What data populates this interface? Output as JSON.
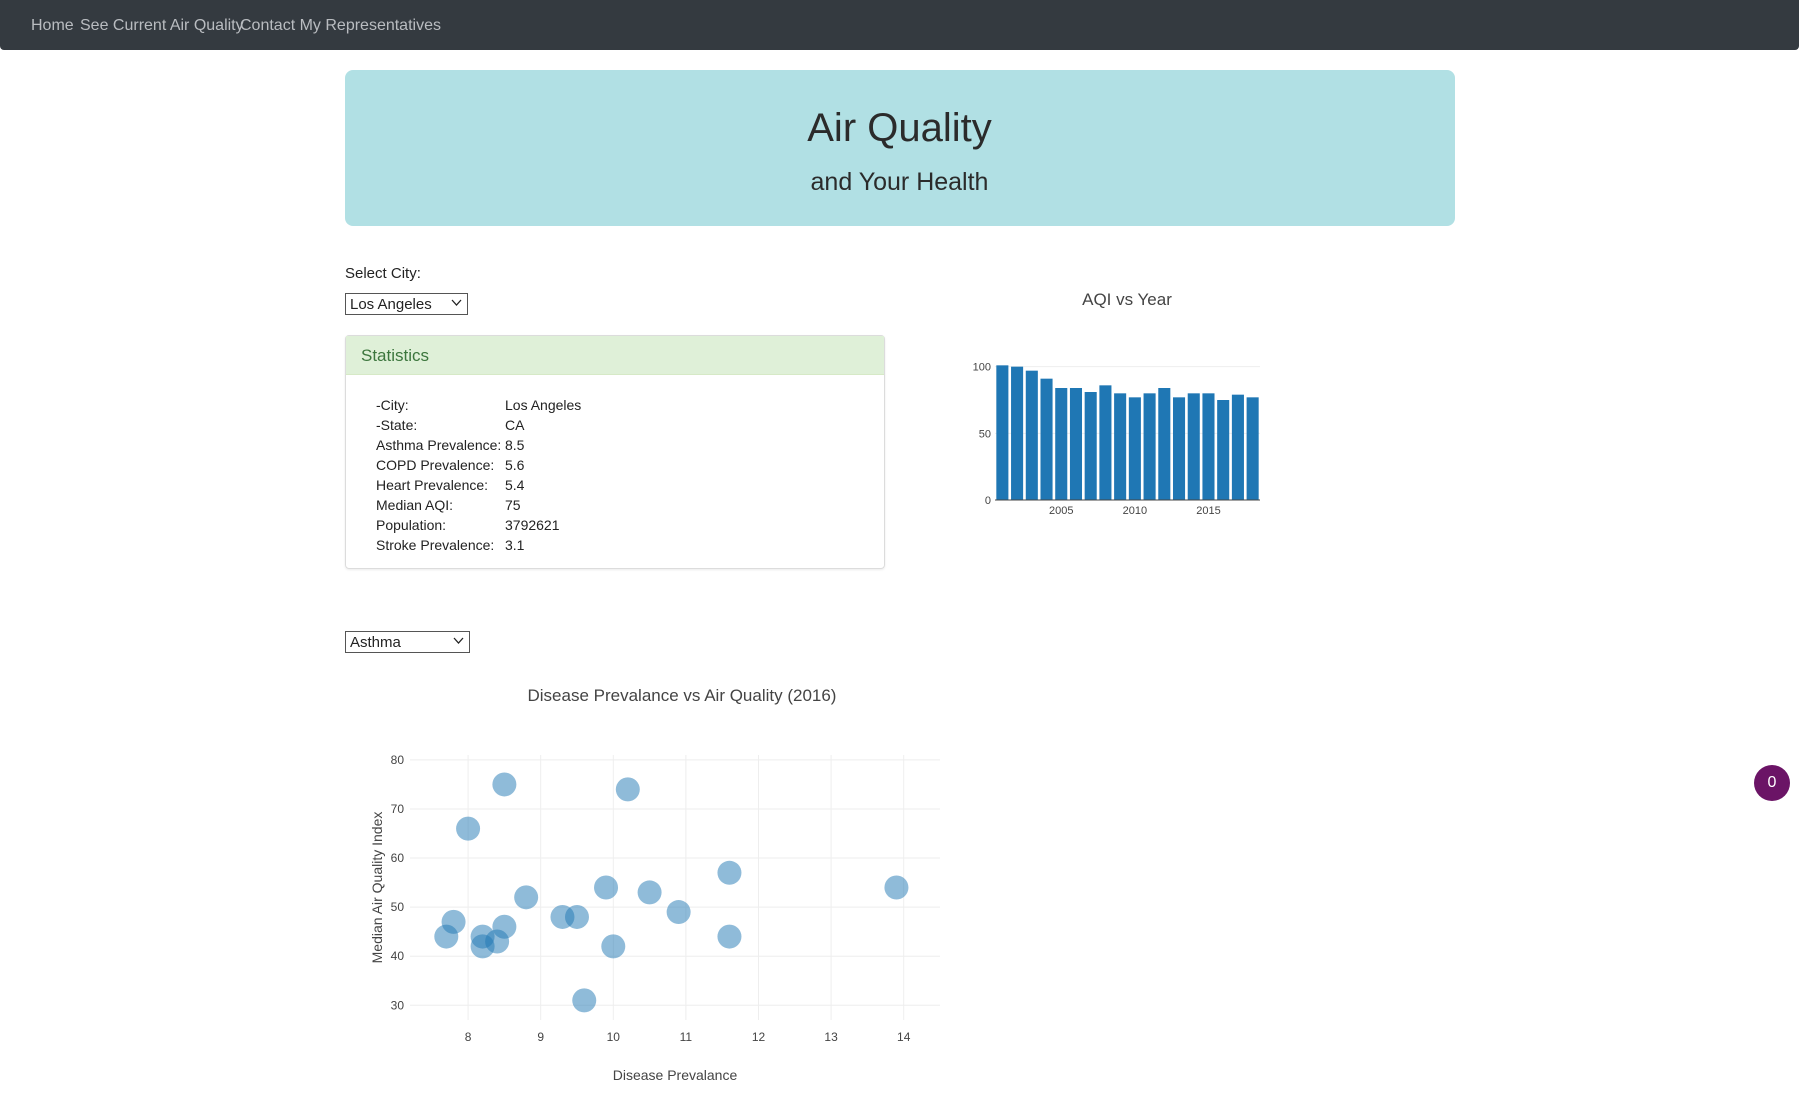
{
  "nav": {
    "items": [
      {
        "label": "Home"
      },
      {
        "label": "See Current Air Quality"
      },
      {
        "label": "Contact My Representatives"
      }
    ]
  },
  "jumbotron": {
    "title": "Air Quality",
    "subtitle": "and Your Health"
  },
  "city_select": {
    "label": "Select City:",
    "value": "Los Angeles"
  },
  "statistics": {
    "title": "Statistics",
    "rows": [
      {
        "key": "-City:",
        "value": "Los Angeles"
      },
      {
        "key": "-State:",
        "value": "CA"
      },
      {
        "key": "Asthma Prevalence:",
        "value": "8.5"
      },
      {
        "key": "COPD Prevalence:",
        "value": "5.6"
      },
      {
        "key": "Heart Prevalence:",
        "value": "5.4"
      },
      {
        "key": "Median AQI:",
        "value": "75"
      },
      {
        "key": "Population:",
        "value": "3792621"
      },
      {
        "key": "Stroke Prevalence:",
        "value": "3.1"
      }
    ]
  },
  "disease_select": {
    "value": "Asthma"
  },
  "badge": {
    "count": "0"
  },
  "colors": {
    "navbar": "#343a40",
    "jumbotron": "#b1e0e4",
    "stats_header": "#dff0d8",
    "bar": "#1f77b4",
    "scatter": "#1f77b4",
    "badge": "#6b1466"
  },
  "chart_data": [
    {
      "type": "bar",
      "title": "AQI vs Year",
      "xlabel": "",
      "ylabel": "",
      "x": [
        2001,
        2002,
        2003,
        2004,
        2005,
        2006,
        2007,
        2008,
        2009,
        2010,
        2011,
        2012,
        2013,
        2014,
        2015,
        2016,
        2017,
        2018
      ],
      "values": [
        101,
        100,
        97,
        91,
        84,
        84,
        81,
        86,
        80,
        77,
        80,
        84,
        77,
        80,
        80,
        75,
        79,
        77
      ],
      "xticks": [
        "2005",
        "2010",
        "2015"
      ],
      "yticks": [
        "0",
        "50",
        "100"
      ],
      "ylim": [
        0,
        105
      ]
    },
    {
      "type": "scatter",
      "title": "Disease Prevalance vs Air Quality (2016)",
      "xlabel": "Disease Prevalance",
      "ylabel": "Median Air Quality Index",
      "xlim": [
        7.2,
        14.5
      ],
      "ylim": [
        27,
        81
      ],
      "xticks": [
        "8",
        "9",
        "10",
        "11",
        "12",
        "13",
        "14"
      ],
      "yticks": [
        "30",
        "40",
        "50",
        "60",
        "70",
        "80"
      ],
      "grid": true,
      "points": [
        {
          "x": 8.5,
          "y": 75
        },
        {
          "x": 10.2,
          "y": 74
        },
        {
          "x": 8.0,
          "y": 66
        },
        {
          "x": 11.6,
          "y": 57
        },
        {
          "x": 9.9,
          "y": 54
        },
        {
          "x": 13.9,
          "y": 54
        },
        {
          "x": 10.5,
          "y": 53
        },
        {
          "x": 8.8,
          "y": 52
        },
        {
          "x": 10.9,
          "y": 49
        },
        {
          "x": 9.3,
          "y": 48
        },
        {
          "x": 9.5,
          "y": 48
        },
        {
          "x": 7.8,
          "y": 47
        },
        {
          "x": 8.5,
          "y": 46
        },
        {
          "x": 7.7,
          "y": 44
        },
        {
          "x": 8.2,
          "y": 44
        },
        {
          "x": 11.6,
          "y": 44
        },
        {
          "x": 8.4,
          "y": 43
        },
        {
          "x": 8.2,
          "y": 42
        },
        {
          "x": 10.0,
          "y": 42
        },
        {
          "x": 9.6,
          "y": 31
        }
      ]
    }
  ]
}
